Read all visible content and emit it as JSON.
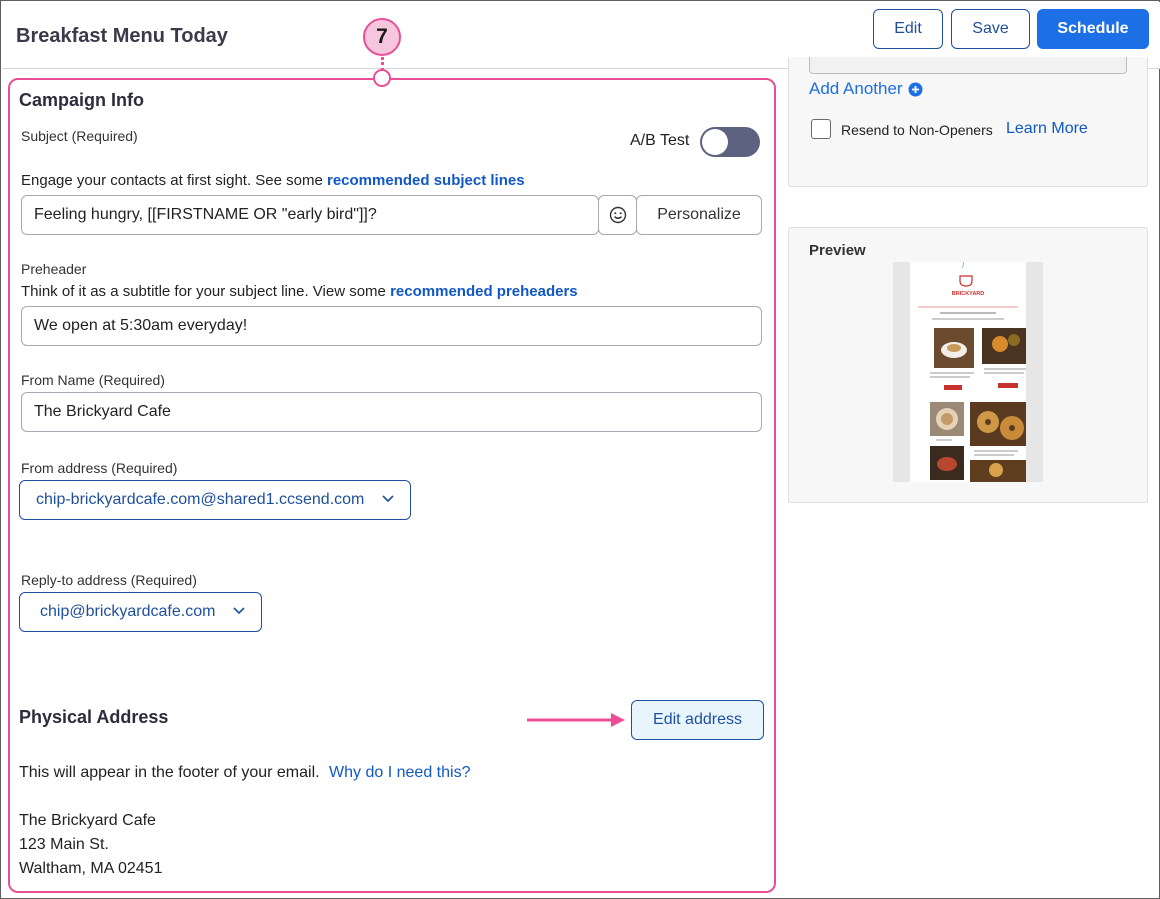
{
  "header": {
    "title": "Breakfast Menu Today",
    "edit_label": "Edit",
    "save_label": "Save",
    "schedule_label": "Schedule"
  },
  "step_marker": "7",
  "campaign_info": {
    "title": "Campaign Info",
    "subject": {
      "label": "Subject (Required)",
      "ab_test_label": "A/B Test",
      "ab_test_on": false,
      "hint": "Engage your contacts at first sight. See some",
      "hint_link": "recommended subject lines",
      "value": "Feeling hungry, [[FIRSTNAME OR \"early bird\"]]?",
      "emoji_icon": "smiley-icon",
      "personalize_label": "Personalize"
    },
    "preheader": {
      "label": "Preheader",
      "hint": "Think of it as a subtitle for your subject line. View some",
      "hint_link": "recommended preheaders",
      "value": "We open at 5:30am everyday!"
    },
    "from_name": {
      "label": "From Name (Required)",
      "value": "The Brickyard Cafe"
    },
    "from_address": {
      "label": "From address (Required)",
      "value": "chip-brickyardcafe.com@shared1.ccsend.com"
    },
    "reply_to": {
      "label": "Reply-to address (Required)",
      "value": "chip@brickyardcafe.com"
    }
  },
  "physical_address": {
    "title": "Physical Address",
    "edit_label": "Edit address",
    "note": "This will appear in the footer of your email.",
    "why_link": "Why do I need this?",
    "lines": [
      "The Brickyard Cafe",
      "123 Main St.",
      "Waltham, MA 02451"
    ]
  },
  "sidebar": {
    "add_another_label": "Add Another",
    "add_icon": "plus-circle-icon",
    "resend_label": "Resend to Non-Openers",
    "resend_checked": false,
    "learn_more_label": "Learn More",
    "preview_title": "Preview",
    "preview_brand": "BRICKYARD"
  },
  "colors": {
    "accent": "#1d6fe6",
    "annotation": "#ea4f96",
    "link": "#1158c7"
  }
}
